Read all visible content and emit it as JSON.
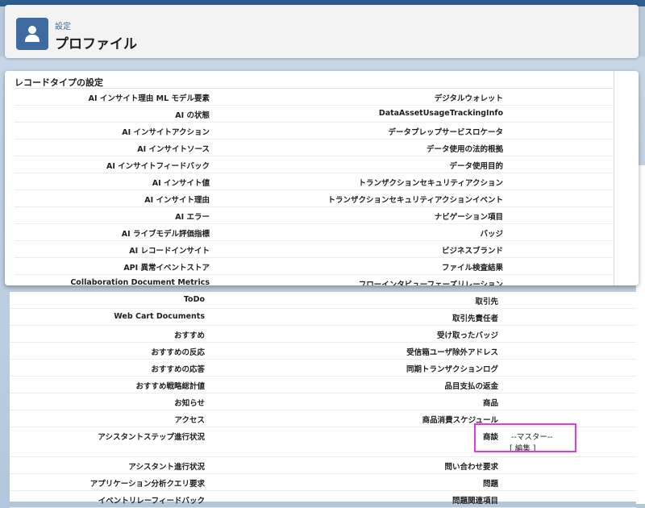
{
  "header": {
    "breadcrumb": "設定",
    "title": "プロファイル"
  },
  "section": {
    "title": "レコードタイプの設定"
  },
  "upper_rows": [
    {
      "left": "AI インサイト理由 ML モデル要素",
      "right": "デジタルウォレット"
    },
    {
      "left": "AI の状態",
      "right": "DataAssetUsageTrackingInfo"
    },
    {
      "left": "AI インサイトアクション",
      "right": "データプレップサービスロケータ"
    },
    {
      "left": "AI インサイトソース",
      "right": "データ使用の法的根拠"
    },
    {
      "left": "AI インサイトフィードバック",
      "right": "データ使用目的"
    },
    {
      "left": "AI インサイト値",
      "right": "トランザクションセキュリティアクション"
    },
    {
      "left": "AI インサイト理由",
      "right": "トランザクションセキュリティアクションイベント"
    },
    {
      "left": "AI エラー",
      "right": "ナビゲーション項目"
    },
    {
      "left": "AI ライブモデル評価指標",
      "right": "バッジ"
    },
    {
      "left": "AI レコードインサイト",
      "right": "ビジネスブランド"
    },
    {
      "left": "API 異常イベントストア",
      "right": "ファイル検査結果"
    },
    {
      "left": "Collaboration Document Metrics",
      "right": "フローインタビューフェーズリレーション"
    }
  ],
  "lower_rows": [
    {
      "left": "ToDo",
      "right": "取引先"
    },
    {
      "left": "Web Cart Documents",
      "right": "取引先責任者"
    },
    {
      "left": "おすすめ",
      "right": "受け取ったバッジ"
    },
    {
      "left": "おすすめの反応",
      "right": "受信箱ユーザ除外アドレス"
    },
    {
      "left": "おすすめの応答",
      "right": "同期トランザクションログ"
    },
    {
      "left": "おすすめ戦略総計値",
      "right": "品目支払の返金"
    },
    {
      "left": "お知らせ",
      "right": "商品"
    },
    {
      "left": "アクセス",
      "right": "商品消費スケジュール"
    },
    {
      "left": "アシスタントステップ進行状況",
      "right": "商談"
    },
    {
      "left": "アシスタント進行状況",
      "right": "問い合わせ要求"
    },
    {
      "left": "アプリケーション分析クエリ要求",
      "right": "問題"
    },
    {
      "left": "イベントリレーフィードバック",
      "right": "問題関連項目"
    }
  ],
  "opportunity": {
    "master_label": "--マスター--",
    "bracket_open": "[",
    "edit_link": "編集",
    "bracket_close": "]"
  },
  "colors": {
    "header_icon_bg": "#3d6aa0",
    "link": "#3b6c9b",
    "highlight_border": "#e33ad9"
  },
  "icons": {
    "header_icon": "user-icon"
  }
}
